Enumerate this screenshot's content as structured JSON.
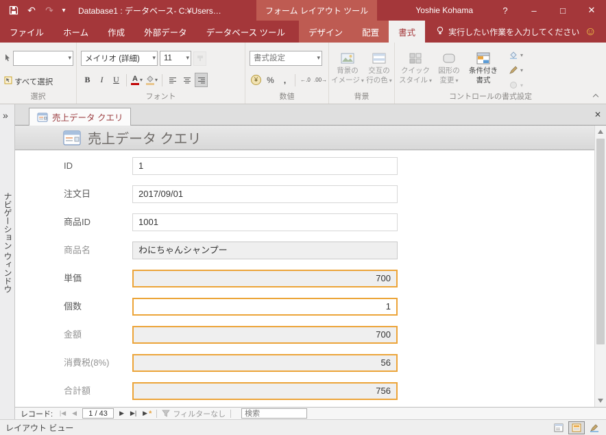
{
  "colors": {
    "accent_red": "#A4373A",
    "contextual_red": "#BE5B52",
    "orange_border": "#ECA438",
    "ribbon_bg": "#F1F0EF"
  },
  "icons": {
    "undo": "↶",
    "redo": "↷",
    "caret": "▾",
    "help": "?",
    "minimize": "–",
    "maximize": "□",
    "close": "✕",
    "smiley": "☺",
    "nav_expand": "»",
    "rec_first": "|◀",
    "rec_prev": "◀",
    "rec_next": "▶",
    "rec_last": "▶|",
    "rec_new_star": "*"
  },
  "titlebar": {
    "app_title": "Database1 : データベース- C:¥Users…",
    "contextual_group": "フォーム レイアウト ツール",
    "user_name": "Yoshie Kohama"
  },
  "tabs": {
    "file": "ファイル",
    "home": "ホーム",
    "create": "作成",
    "external_data": "外部データ",
    "db_tools": "データベース ツール",
    "design": "デザイン",
    "arrange": "配置",
    "format": "書式",
    "tell_me": "実行したい作業を入力してください"
  },
  "ribbon": {
    "selection": {
      "group_label": "選択",
      "select_all": "すべて選択"
    },
    "font": {
      "group_label": "フォント",
      "font_name": "メイリオ (詳細)",
      "font_size": "11",
      "bold": "B",
      "italic": "I",
      "underline": "U",
      "font_color_letter": "A"
    },
    "number": {
      "group_label": "数値",
      "format_placeholder": "書式設定",
      "currency": "¥",
      "percent": "%",
      "comma": ",",
      "dec_increase": "←.0",
      "dec_decrease": ".00→"
    },
    "background": {
      "group_label": "背景",
      "bg_image_line1": "背景の",
      "bg_image_line2": "イメージ",
      "alt_row_line1": "交互の",
      "alt_row_line2": "行の色"
    },
    "control_format": {
      "group_label": "コントロールの書式設定",
      "quick_style_line1": "クイック",
      "quick_style_line2": "スタイル",
      "change_shape_line1": "図形の",
      "change_shape_line2": "変更",
      "conditional_line1": "条件付き",
      "conditional_line2": "書式"
    }
  },
  "document_tab": {
    "title": "売上データ クエリ"
  },
  "nav_pane": {
    "title": "ナビゲーション ウィンドウ"
  },
  "form": {
    "title": "売上データ クエリ",
    "fields": [
      {
        "label": "ID",
        "value": "1"
      },
      {
        "label": "注文日",
        "value": "2017/09/01"
      },
      {
        "label": "商品ID",
        "value": "1001"
      },
      {
        "label": "商品名",
        "value": "わにちゃんシャンプー"
      },
      {
        "label": "単価",
        "value": "700"
      },
      {
        "label": "個数",
        "value": "1"
      },
      {
        "label": "金額",
        "value": "700"
      },
      {
        "label": "消費税(8%)",
        "value": "56"
      },
      {
        "label": "合計額",
        "value": "756"
      }
    ]
  },
  "record_nav": {
    "label": "レコード:",
    "position": "1 / 43",
    "filter_status": "フィルターなし",
    "search_placeholder": "検索"
  },
  "status_bar": {
    "view_name": "レイアウト ビュー"
  }
}
